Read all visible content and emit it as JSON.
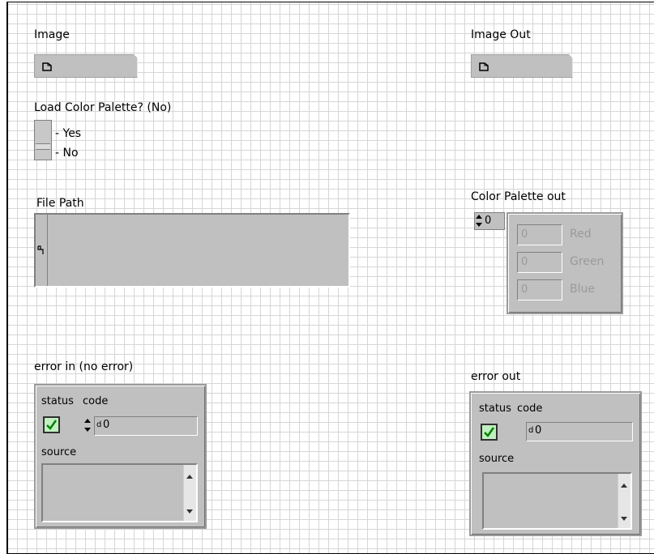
{
  "image": {
    "label": "Image"
  },
  "image_out": {
    "label": "Image Out"
  },
  "load_palette": {
    "label": "Load Color Palette? (No)",
    "yes": "- Yes",
    "no": "- No"
  },
  "file_path": {
    "label": "File Path"
  },
  "color_palette_out": {
    "label": "Color Palette out",
    "index": "0",
    "fields": [
      {
        "value": "0",
        "name": "Red"
      },
      {
        "value": "0",
        "name": "Green"
      },
      {
        "value": "0",
        "name": "Blue"
      }
    ]
  },
  "error_in": {
    "label": "error in (no error)",
    "status": "status",
    "code_label": "code",
    "code_value": "0",
    "source": "source"
  },
  "error_out": {
    "label": "error out",
    "status": "status",
    "code_label": "code",
    "code_value": "0",
    "source": "source"
  },
  "colors": {
    "grid": "#d6d6d6",
    "control_gray": "#c0c0c0",
    "check_green": "#00a000"
  },
  "icons": {
    "refnum": "document-icon",
    "path": "path-icon",
    "check": "checkmark-icon"
  }
}
